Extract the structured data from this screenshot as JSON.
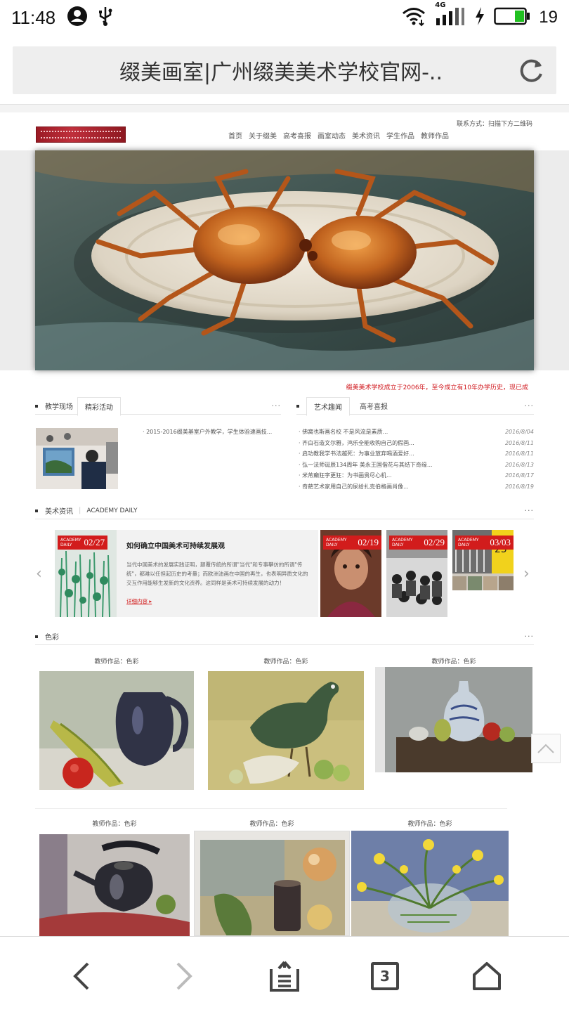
{
  "status_bar": {
    "time": "11:48",
    "network": "4G",
    "battery": "19"
  },
  "browser": {
    "page_title": "缀美画室|广州缀美美术学校官网-.."
  },
  "site": {
    "contact": "联系方式：扫描下方二维码",
    "nav": [
      "首页",
      "关于缀美",
      "高考喜报",
      "画室动态",
      "美术资讯",
      "学生作品",
      "教师作品"
    ],
    "marquee": "缀美美术学校成立于2006年，至今成立有10年办学历史，现已成",
    "section1": {
      "tab1": "教学现场",
      "tab2": "精彩活动",
      "more": "···",
      "caption": "· 2015-2016缀美基室户外教学，学生体验速画技..."
    },
    "section2": {
      "tab1": "艺术趣闻",
      "tab2": "高考喜报",
      "more": "···",
      "items": [
        {
          "title": "· 佛窝也斯画名校 不是风流是素质...",
          "date": "2016/8/04"
        },
        {
          "title": "· 齐白石造文尔雅，鸿乐全能收购自己的假画...",
          "date": "2016/8/11"
        },
        {
          "title": "· 启功教我学书法越死：为事业放弃喝酒爱好...",
          "date": "2016/8/11"
        },
        {
          "title": "· 弘一法师诞辰134周年 美永王国偕花与其结下奇缘...",
          "date": "2016/8/13"
        },
        {
          "title": "· 米芾癫狂字更狂：为书画贵尽心机...",
          "date": "2016/8/17"
        },
        {
          "title": "· 奇葩艺术家用自己的尿给扎克伯格画肖像...",
          "date": "2016/8/19"
        }
      ]
    },
    "section3": {
      "title": "美术资讯",
      "subtitle": "ACADEMY DAILY",
      "more": "···",
      "badge_label": "ACADEMY DAILY",
      "featured": {
        "date": "02/27",
        "title": "如何确立中国美术可持续发展观",
        "text": "当代中国美术的发展实践证明，颠覆传统的所谓\"当代\"和专事攀仿的所谓\"传统\"，都难以任担起历史的考量；而欧洲油画在中国的再生，也表明异质文化的交互作用能够生发新的文化资养。这同样是美术可持续发展的动力！",
        "more": "详细内容"
      },
      "thumbs": [
        {
          "date": "02/19"
        },
        {
          "date": "02/29"
        },
        {
          "date": "03/03"
        }
      ]
    },
    "section4": {
      "title": "色彩",
      "more": "···",
      "captions": [
        "教师作品：色彩",
        "教师作品：色彩",
        "教师作品：色彩",
        "教师作品：色彩",
        "教师作品：色彩",
        "教师作品：色彩"
      ]
    }
  },
  "bottom_bar": {
    "tabs_count": "3"
  },
  "colors": {
    "accent_red": "#d21c1c",
    "url_bar_bg": "#eeeeee"
  }
}
